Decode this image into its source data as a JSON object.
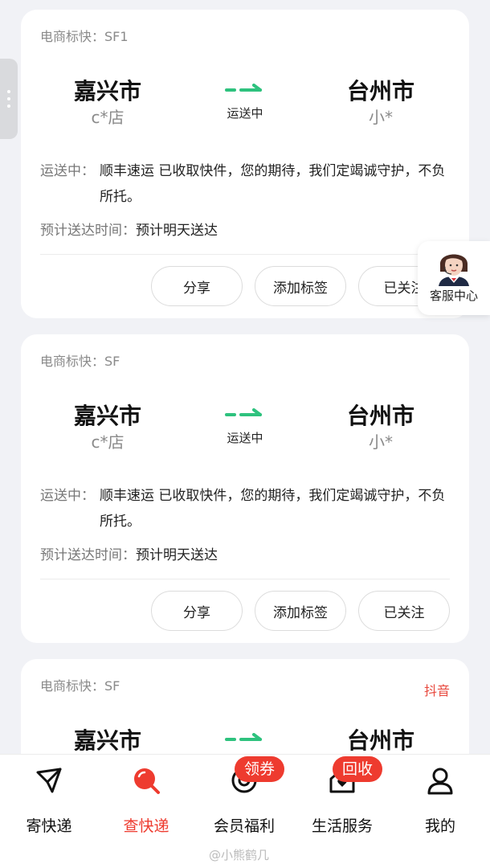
{
  "cards": [
    {
      "tag": "电商标快：SF1",
      "platform": "",
      "from_city": "嘉兴市",
      "from_shop": "c*店",
      "to_city": "台州市",
      "to_shop": "小*",
      "status": "运送中",
      "progress_label": "运送中：",
      "progress_text": "顺丰速运 已收取快件，您的期待，我们定竭诚守护，不负所托。",
      "eta_label": "预计送达时间：",
      "eta_value": "预计明天送达",
      "buttons": {
        "share": "分享",
        "add_tag": "添加标签",
        "follow": "已关注"
      }
    },
    {
      "tag": "电商标快：SF",
      "platform": "",
      "from_city": "嘉兴市",
      "from_shop": "c*店",
      "to_city": "台州市",
      "to_shop": "小*",
      "status": "运送中",
      "progress_label": "运送中：",
      "progress_text": "顺丰速运 已收取快件，您的期待，我们定竭诚守护，不负所托。",
      "eta_label": "预计送达时间：",
      "eta_value": "预计明天送达",
      "buttons": {
        "share": "分享",
        "add_tag": "添加标签",
        "follow": "已关注"
      }
    },
    {
      "tag": "电商标快：SF",
      "platform": "抖音",
      "from_city": "嘉兴市",
      "to_city": "台州市"
    }
  ],
  "customer_service": {
    "label": "客服中心",
    "icon": "agent-avatar-icon"
  },
  "tabbar": {
    "items": [
      {
        "label": "寄快递",
        "icon": "send-plane-icon",
        "active": false,
        "badge": ""
      },
      {
        "label": "查快递",
        "icon": "search-parcel-icon",
        "active": true,
        "badge": ""
      },
      {
        "label": "会员福利",
        "icon": "member-coin-icon",
        "active": false,
        "badge": "领券"
      },
      {
        "label": "生活服务",
        "icon": "home-heart-icon",
        "active": false,
        "badge": "回收"
      },
      {
        "label": "我的",
        "icon": "user-icon",
        "active": false,
        "badge": ""
      }
    ]
  },
  "watermark": "@小熊鹤几",
  "colors": {
    "accent": "#ee3b2f",
    "route_green": "#2ec27e",
    "background": "#f1f2f6"
  }
}
